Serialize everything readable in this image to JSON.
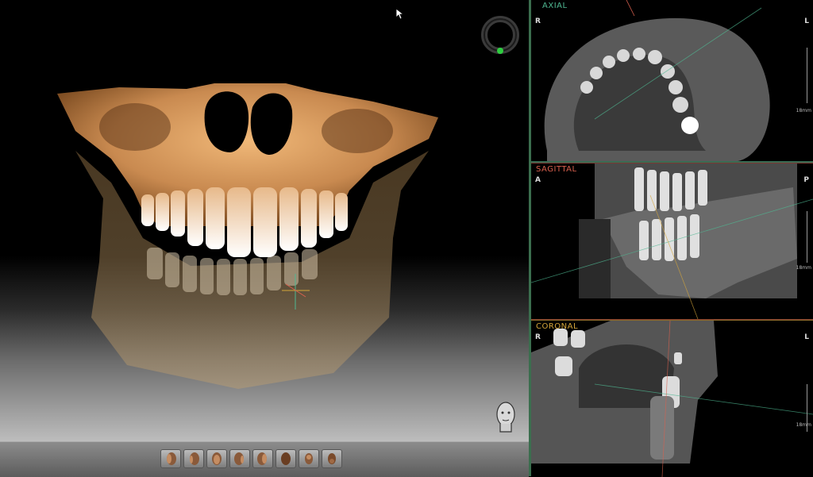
{
  "panels": {
    "axial": {
      "label": "AXIAL",
      "left": "R",
      "right": "L",
      "scale": "18mm",
      "color": "#4fb892"
    },
    "sagittal": {
      "label": "SAGITTAL",
      "left": "A",
      "right": "P",
      "scale": "18mm",
      "color": "#d9604e"
    },
    "coronal": {
      "label": "CORONAL",
      "left": "R",
      "right": "L",
      "scale": "18mm",
      "color": "#d4a53a"
    }
  },
  "toolbar": {
    "views": [
      {
        "name": "view-right-oblique"
      },
      {
        "name": "view-right"
      },
      {
        "name": "view-front"
      },
      {
        "name": "view-left"
      },
      {
        "name": "view-left-oblique"
      },
      {
        "name": "view-back"
      },
      {
        "name": "view-top"
      },
      {
        "name": "view-bottom"
      }
    ]
  },
  "icons": {
    "cursor": "arrow-cursor-icon",
    "rotate": "rotation-ring-icon",
    "orientation": "head-orientation-icon"
  },
  "colors": {
    "bone": "#d89a5a",
    "teeth": "#f3e6d6",
    "divider": "#3b6e4e"
  }
}
